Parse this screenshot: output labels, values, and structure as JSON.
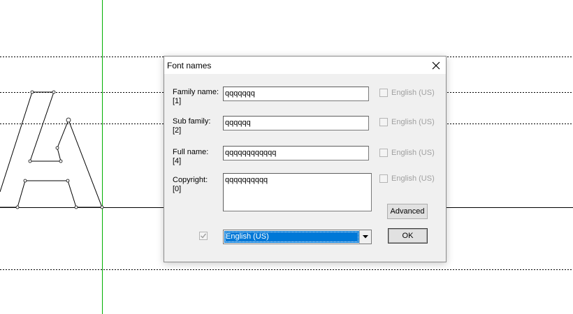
{
  "dialog": {
    "title": "Font names",
    "close_icon": "close-icon",
    "fields": [
      {
        "label": "Family name:\n[1]",
        "value": "qqqqqqq",
        "checkbox_label": "English (US)",
        "checked": false
      },
      {
        "label": "Sub family:\n[2]",
        "value": "qqqqqq",
        "checkbox_label": "English (US)",
        "checked": false
      },
      {
        "label": "Full name:\n[4]",
        "value": "qqqqqqqqqqqq",
        "checkbox_label": "English (US)",
        "checked": false
      },
      {
        "label": "Copyright:\n[0]",
        "value": "qqqqqqqqqq",
        "checkbox_label": "English (US)",
        "checked": false
      }
    ],
    "advanced_label": "Advanced",
    "ok_label": "OK",
    "language_select": {
      "value": "English (US)"
    },
    "language_checked": true
  },
  "colors": {
    "guide_vertical": "#00b000",
    "selection": "#0078d7"
  }
}
